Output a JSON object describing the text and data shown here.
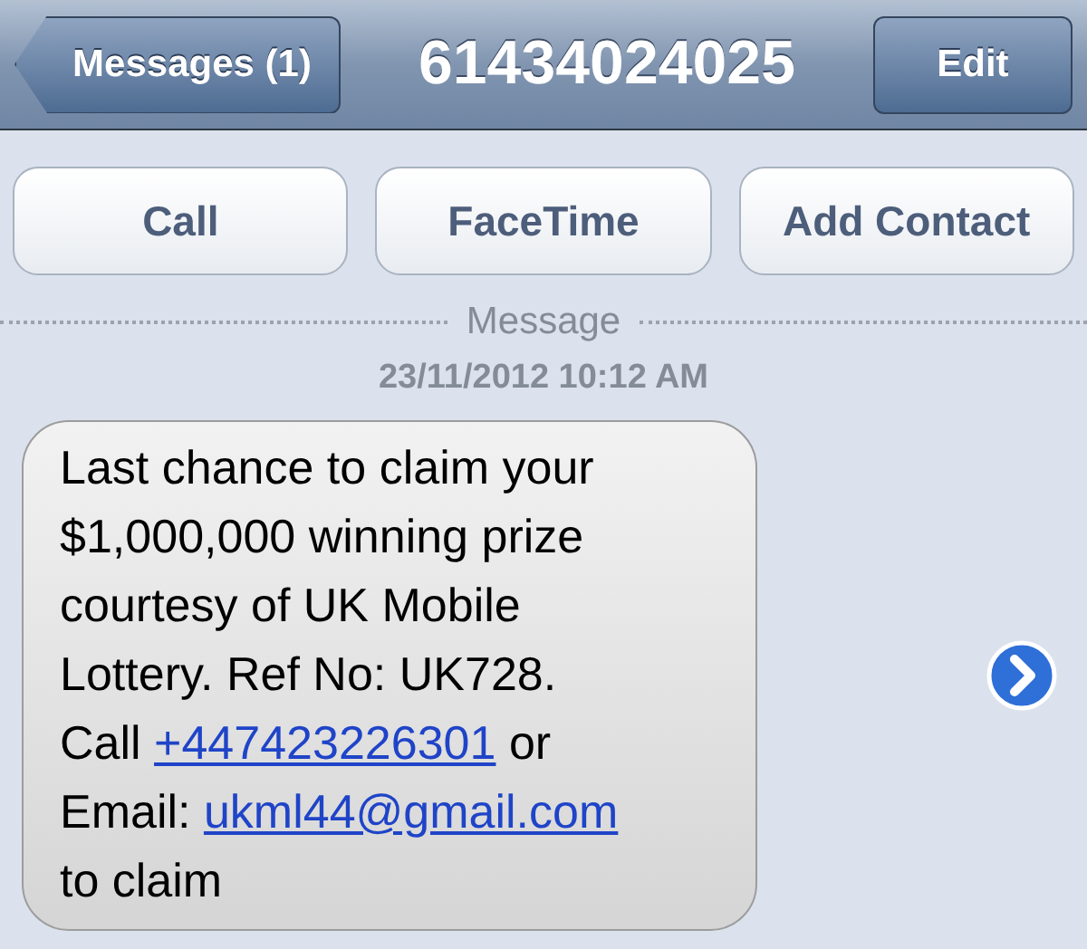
{
  "nav": {
    "back_button": "Messages (1)",
    "title": "61434024025",
    "edit_button": "Edit"
  },
  "actions": [
    "Call",
    "FaceTime",
    "Add Contact"
  ],
  "thread": {
    "label": "Message",
    "timestamp": "23/11/2012 10:12 AM"
  },
  "message": {
    "lines": [
      [
        {
          "kind": "text",
          "text": "Last chance to claim your"
        }
      ],
      [
        {
          "kind": "text",
          "text": "$1,000,000 winning prize"
        }
      ],
      [
        {
          "kind": "text",
          "text": "courtesy of UK Mobile"
        }
      ],
      [
        {
          "kind": "text",
          "text": "Lottery. Ref No: UK728."
        }
      ],
      [
        {
          "kind": "text",
          "text": "Call "
        },
        {
          "kind": "link",
          "text": "+447423226301"
        },
        {
          "kind": "text",
          "text": " or"
        }
      ],
      [
        {
          "kind": "text",
          "text": "Email: "
        },
        {
          "kind": "link",
          "text": "ukml44@gmail.com"
        }
      ],
      [
        {
          "kind": "text",
          "text": "to claim"
        }
      ]
    ]
  }
}
